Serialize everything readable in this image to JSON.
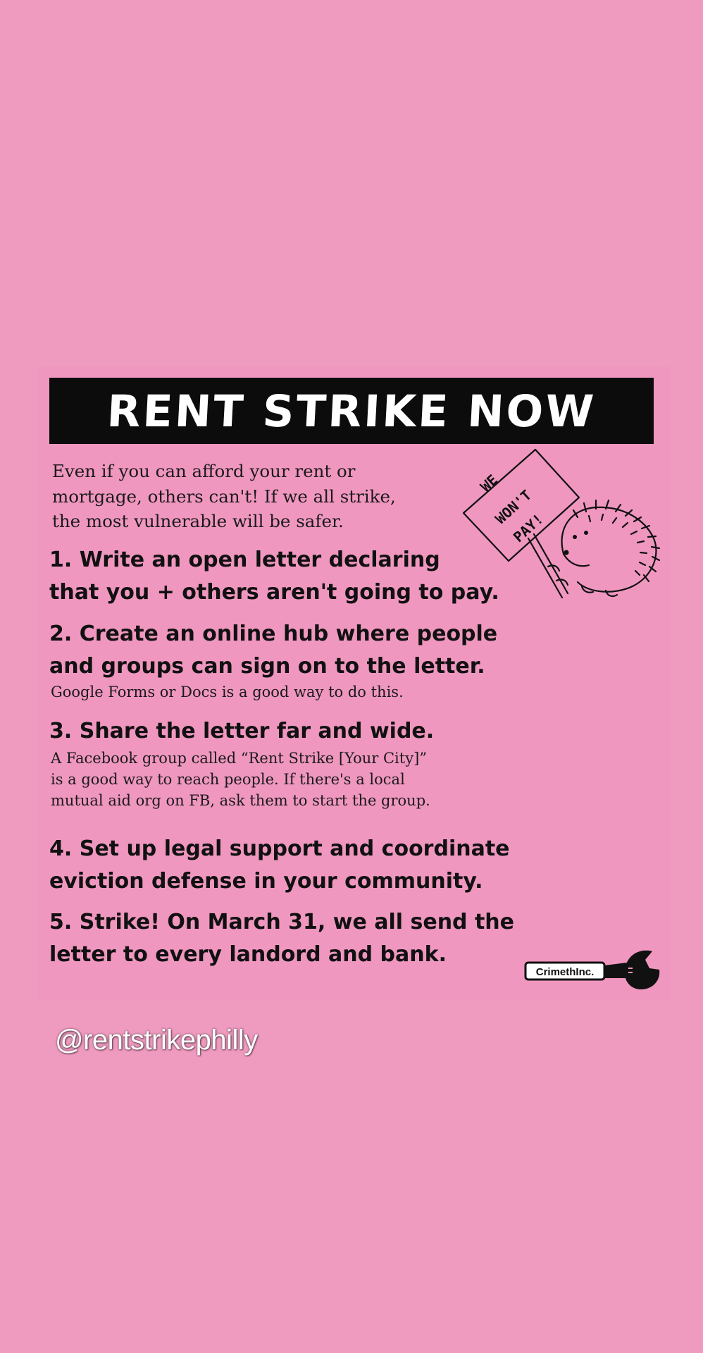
{
  "poster": {
    "title": "RENT STRIKE NOW",
    "intro_lines": [
      "Even if you can afford your rent or",
      "mortgage, others can't! If we all strike,",
      "the most vulnerable will be safer."
    ],
    "steps": [
      {
        "lines": [
          "1. Write an open letter declaring",
          "that you + others aren't going to pay."
        ],
        "note": []
      },
      {
        "lines": [
          "2. Create an online hub where people",
          "and groups can sign on to the letter."
        ],
        "note": [
          "Google Forms or Docs is a good way to do this."
        ]
      },
      {
        "lines": [
          "3. Share the letter far and wide."
        ],
        "note": [
          "A Facebook group called “Rent Strike [Your City]”",
          "is a good way to reach people. If there's a local",
          "mutual aid org on FB, ask them to start the group."
        ]
      },
      {
        "lines": [
          "4. Set up legal support and coordinate",
          "eviction defense in your community."
        ],
        "note": []
      },
      {
        "lines": [
          "5. Strike! On March 31, we all send the",
          "letter to every landord and bank."
        ],
        "note": []
      }
    ],
    "sign_text": [
      "WE",
      "WON'T",
      "PAY!"
    ],
    "logo_text": "CrimethInc."
  },
  "handle": "@rentstrikephilly",
  "colors": {
    "background": "#ef9bc0",
    "title_bar": "#0c0c0c",
    "text": "#111111"
  }
}
